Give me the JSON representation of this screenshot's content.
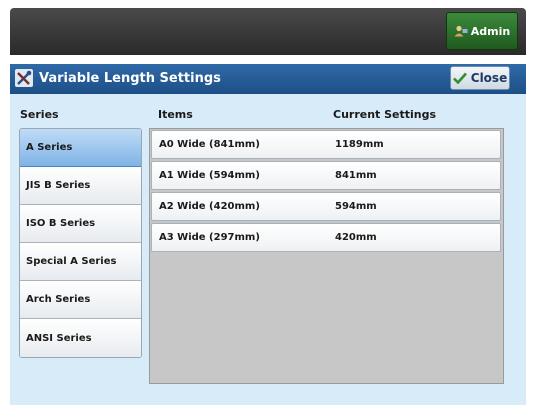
{
  "header": {
    "admin_label": "Admin"
  },
  "window": {
    "title": "Variable Length Settings",
    "close_label": "Close"
  },
  "columns": {
    "series": "Series",
    "items": "Items",
    "current": "Current Settings"
  },
  "series": [
    {
      "label": "A Series",
      "selected": true
    },
    {
      "label": "JIS B Series",
      "selected": false
    },
    {
      "label": "ISO B Series",
      "selected": false
    },
    {
      "label": "Special A Series",
      "selected": false
    },
    {
      "label": "Arch Series",
      "selected": false
    },
    {
      "label": "ANSI Series",
      "selected": false
    }
  ],
  "items": [
    {
      "label": "A0 Wide (841mm)",
      "value": "1189mm"
    },
    {
      "label": "A1 Wide (594mm)",
      "value": "841mm"
    },
    {
      "label": "A2 Wide (420mm)",
      "value": "594mm"
    },
    {
      "label": "A3 Wide (297mm)",
      "value": "420mm"
    }
  ],
  "colors": {
    "accent": "#2f6aa8",
    "panel": "#d8ebf8",
    "admin": "#2e7a2e"
  }
}
